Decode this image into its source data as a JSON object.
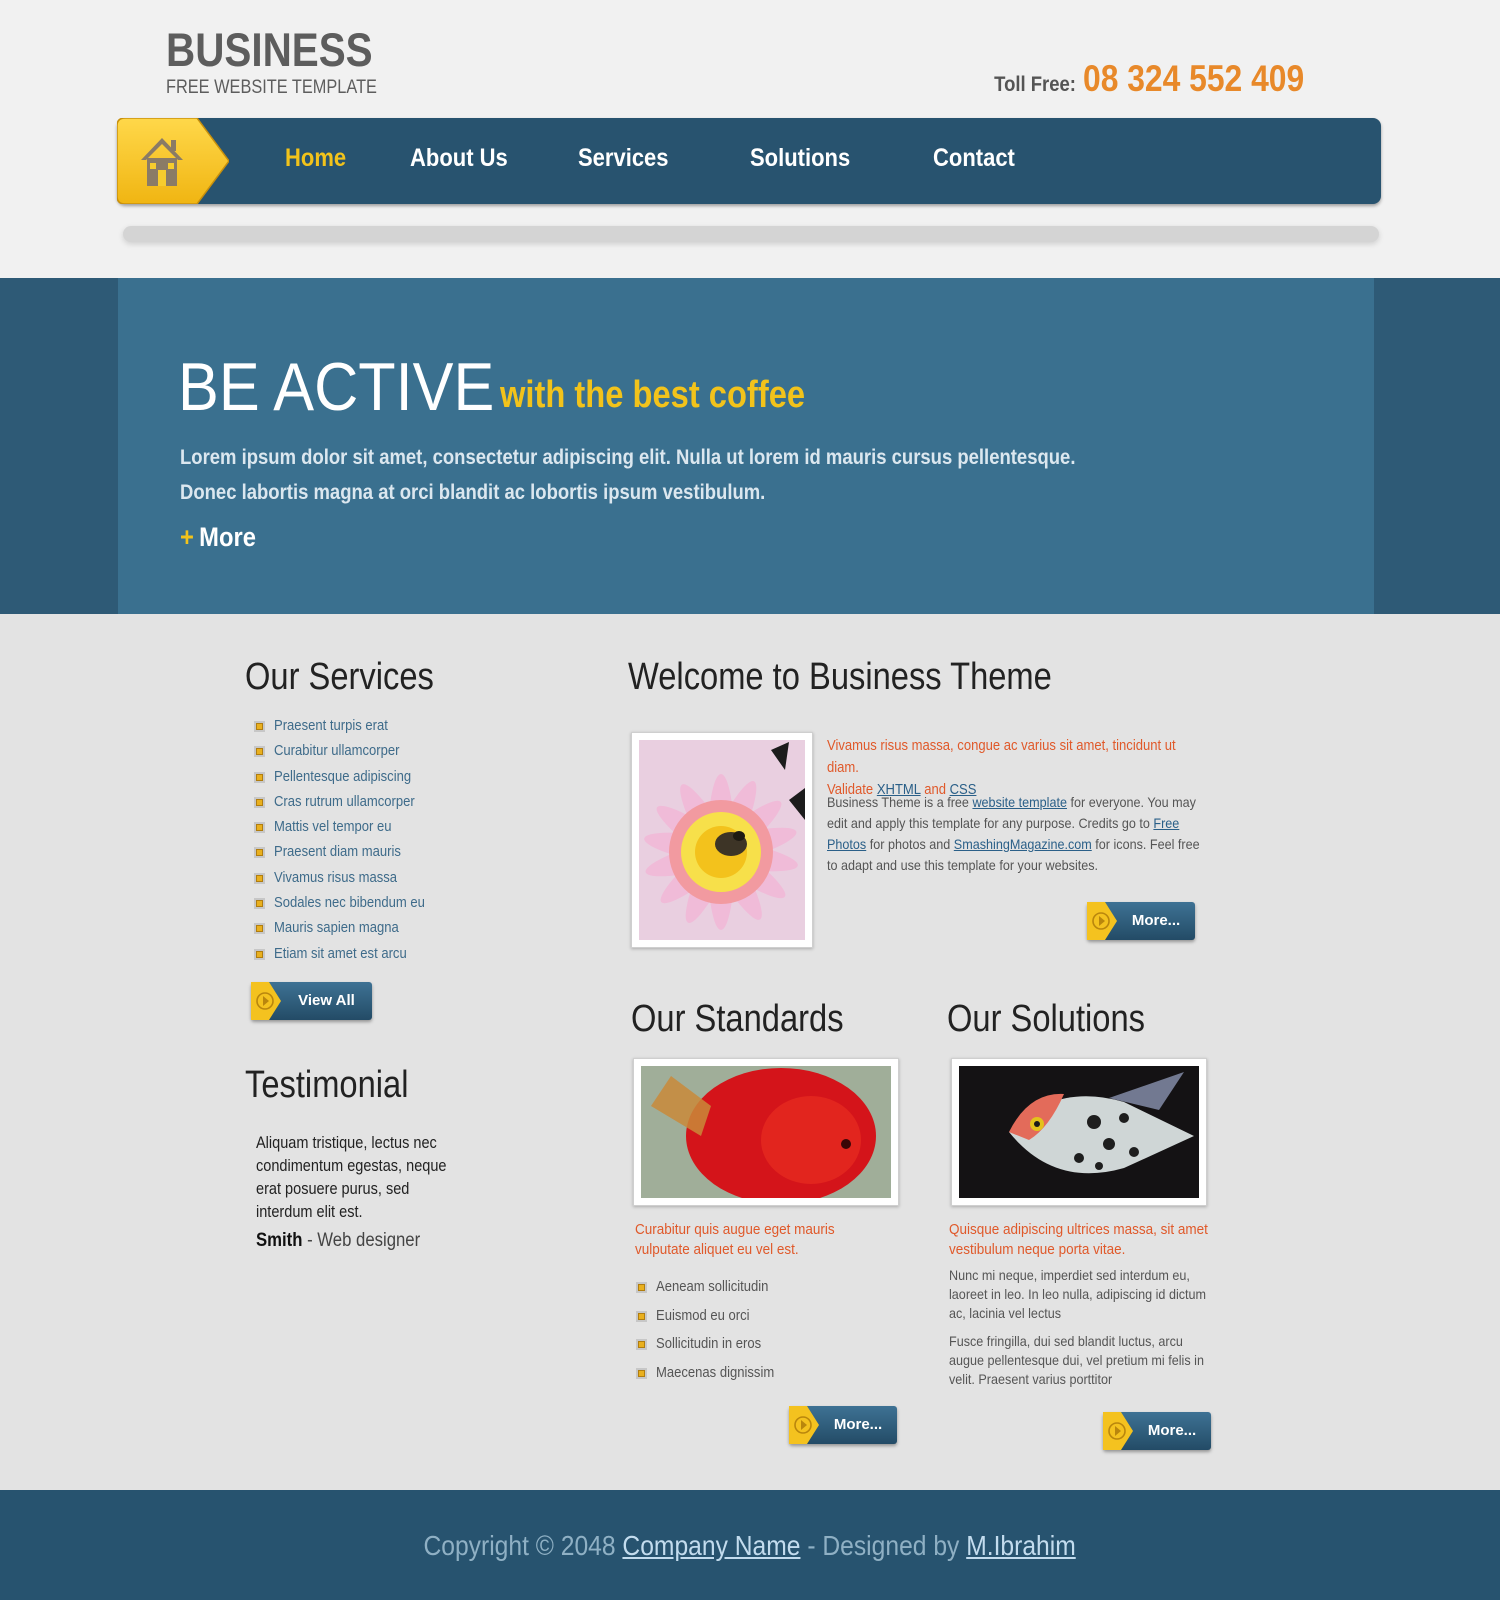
{
  "header": {
    "logo_title": "BUSINESS",
    "logo_subtitle": "FREE WEBSITE TEMPLATE",
    "toll_free_label": "Toll Free:",
    "toll_free_number": "08 324 552 409"
  },
  "nav": {
    "home_icon": "house-icon",
    "items": [
      {
        "label": "Home",
        "active": true
      },
      {
        "label": "About Us",
        "active": false
      },
      {
        "label": "Services",
        "active": false
      },
      {
        "label": "Solutions",
        "active": false
      },
      {
        "label": "Contact",
        "active": false
      }
    ]
  },
  "hero": {
    "title": "BE ACTIVE",
    "tagline": "with the best coffee",
    "text_line1": "Lorem ipsum dolor sit amet, consectetur adipiscing elit. Nulla ut lorem id mauris cursus pellentesque.",
    "text_line2": "Donec labortis magna at orci blandit ac lobortis ipsum vestibulum.",
    "more_plus": "+",
    "more_label": "More"
  },
  "services": {
    "heading": "Our Services",
    "items": [
      "Praesent turpis erat",
      "Curabitur ullamcorper",
      "Pellentesque adipiscing",
      "Cras rutrum ullamcorper",
      "Mattis vel tempor eu",
      "Praesent diam mauris",
      "Vivamus risus massa",
      "Sodales nec bibendum eu",
      "Mauris sapien magna",
      "Etiam sit amet est arcu"
    ],
    "button_label": "View All"
  },
  "testimonial": {
    "heading": "Testimonial",
    "text": "Aliquam tristique, lectus nec condimentum egestas, neque erat posuere purus, sed interdum elit est.",
    "author_name": "Smith",
    "author_role": " - Web designer"
  },
  "welcome": {
    "heading": "Welcome to Business Theme",
    "intro": "Vivamus risus massa, congue ac varius sit amet, tincidunt ut diam.",
    "validate_prefix": "Validate ",
    "validate_xhtml": "XHTML",
    "validate_and": " and ",
    "validate_css": "CSS",
    "body_1": "Business Theme is a free ",
    "link_website_template": "website template",
    "body_2": " for everyone. You may edit and apply this template for any purpose. Credits go to ",
    "link_free_photos": "Free Photos",
    "body_3": " for photos and ",
    "link_smashing": "SmashingMagazine.com",
    "body_4": " for icons. Feel free to adapt and use this template for your websites.",
    "button_label": "More...",
    "image": "flower-photo"
  },
  "standards": {
    "heading": "Our Standards",
    "image": "red-fish-photo",
    "caption": "Curabitur quis augue eget mauris vulputate aliquet eu vel est.",
    "items": [
      "Aeneam sollicitudin",
      "Euismod eu orci",
      "Sollicitudin in eros",
      "Maecenas dignissim"
    ],
    "button_label": "More..."
  },
  "solutions": {
    "heading": "Our Solutions",
    "image": "angelfish-photo",
    "caption": "Quisque adipiscing ultrices massa, sit amet vestibulum neque porta vitae.",
    "para1": "Nunc mi neque, imperdiet sed interdum eu, laoreet in leo. In leo nulla, adipiscing id dictum ac, lacinia vel lectus",
    "para2": "Fusce fringilla, dui sed blandit luctus, arcu augue pellentesque dui, vel pretium mi felis in velit. Praesent varius porttitor",
    "button_label": "More..."
  },
  "footer": {
    "copyright": "Copyright © 2048 ",
    "company": "Company Name",
    "designed_by": " - Designed by ",
    "designer": "M.Ibrahim"
  },
  "colors": {
    "nav_bg": "#28536f",
    "hero_bg": "#3a708f",
    "accent_yellow": "#f2c31b",
    "accent_orange": "#e8892a",
    "caption_orange": "#e0592a",
    "page_bg": "#e3e3e3"
  }
}
